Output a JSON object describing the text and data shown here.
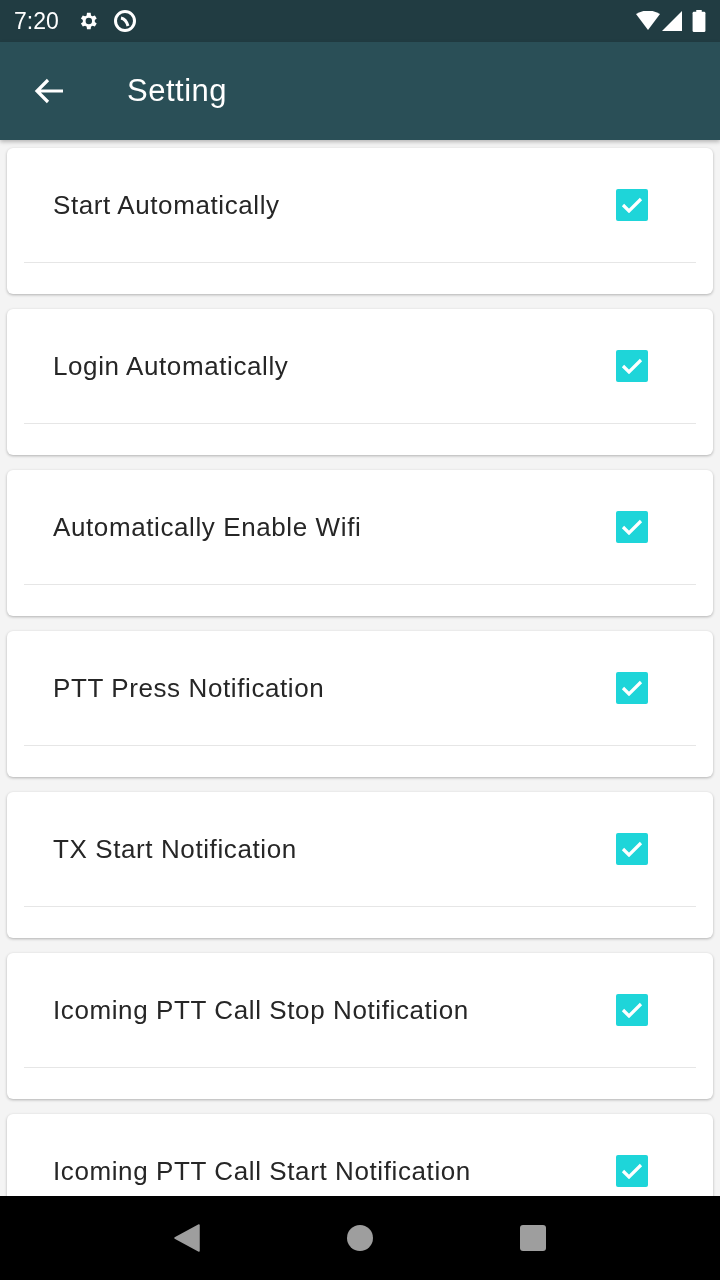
{
  "status_bar": {
    "time": "7:20"
  },
  "app_bar": {
    "title": "Setting"
  },
  "settings": [
    {
      "label": "Start Automatically",
      "checked": true
    },
    {
      "label": "Login Automatically",
      "checked": true
    },
    {
      "label": "Automatically Enable Wifi",
      "checked": true
    },
    {
      "label": "PTT Press Notification",
      "checked": true
    },
    {
      "label": "TX Start Notification",
      "checked": true
    },
    {
      "label": "Icoming PTT Call Stop Notification",
      "checked": true
    },
    {
      "label": "Icoming PTT Call Start Notification",
      "checked": true
    }
  ]
}
